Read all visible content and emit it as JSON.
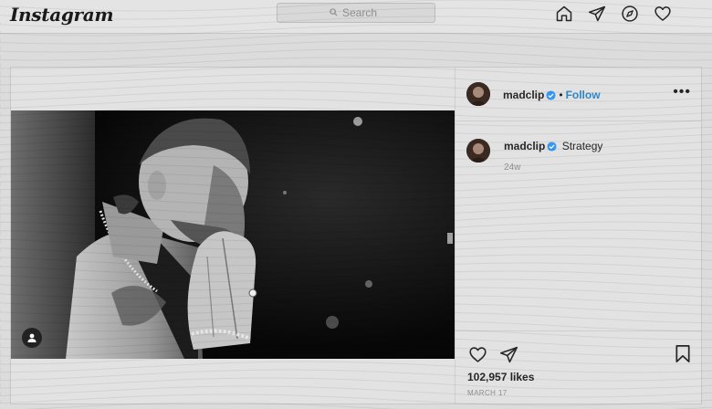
{
  "app": {
    "logo": "Instagram"
  },
  "search": {
    "placeholder": "Search"
  },
  "nav": {
    "icons": [
      "home-icon",
      "direct-icon",
      "explore-icon",
      "activity-icon"
    ]
  },
  "post": {
    "username": "madclip",
    "verified": true,
    "separator": "•",
    "follow_label": "Follow",
    "more_label": "•••",
    "caption": {
      "username": "madclip",
      "text": "Strategy",
      "age": "24w"
    },
    "likes": "102,957 likes",
    "date": "MARCH 17",
    "actions": [
      "like-icon",
      "share-icon",
      "bookmark-icon"
    ]
  },
  "colors": {
    "link_blue": "#2f87c8",
    "verified_blue": "#3897f0",
    "muted_text": "#8e8e8e"
  }
}
